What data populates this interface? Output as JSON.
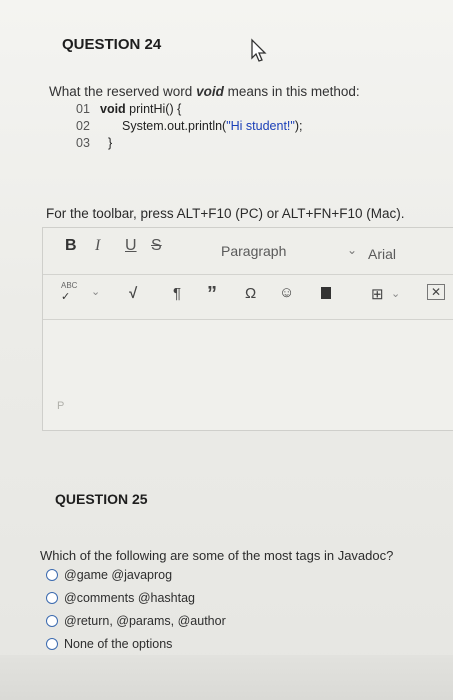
{
  "question24": {
    "heading": "QUESTION 24",
    "prompt_pre": "What the reserved word ",
    "prompt_keyword": "void",
    "prompt_post": " means in this method:",
    "code": [
      {
        "num": "01",
        "kw": "void",
        "text": " printHi() {"
      },
      {
        "num": "02",
        "text": "System.out.println(",
        "str": "\"Hi student!\"",
        "tail": ");"
      },
      {
        "num": "03",
        "text": "}"
      }
    ],
    "toolbar_hint": "For the toolbar, press ALT+F10 (PC) or ALT+FN+F10 (Mac).",
    "editor": {
      "bold": "B",
      "italic": "I",
      "underline": "U",
      "strike": "S",
      "paragraph": "Paragraph",
      "font": "Arial",
      "spellcheck": "ABC",
      "path": "P"
    }
  },
  "question25": {
    "heading": "QUESTION 25",
    "prompt": "Which of the following are some of the most tags in Javadoc?",
    "options": [
      "@game @javaprog",
      "@comments @hashtag",
      "@return, @params, @author",
      "None of the options"
    ]
  },
  "colors": {
    "radio_border": "#3c6bb0",
    "string_literal": "#1a3fb8"
  }
}
